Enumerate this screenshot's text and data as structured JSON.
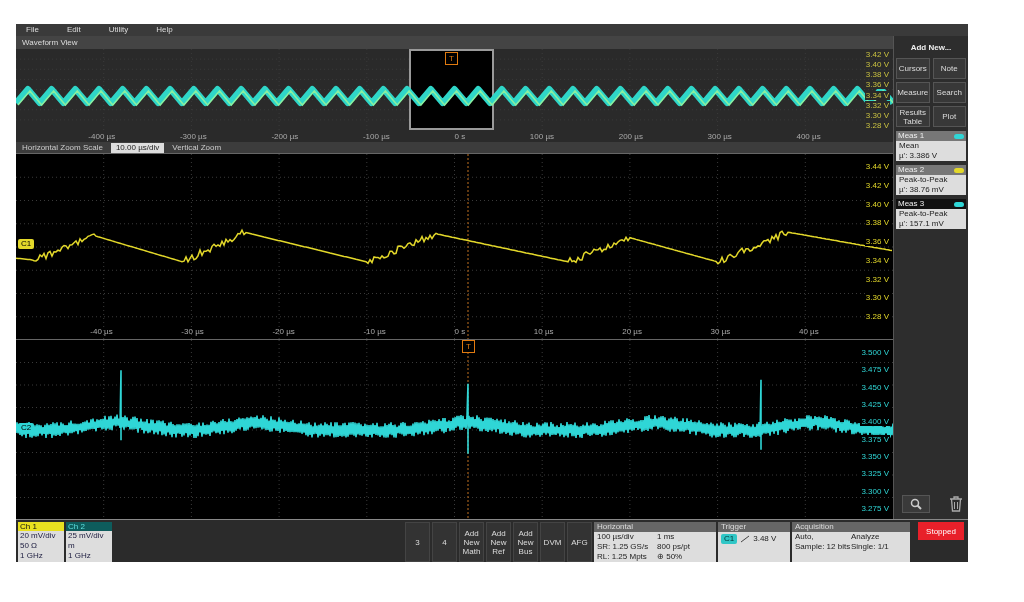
{
  "menu": [
    "File",
    "Edit",
    "Utility",
    "Help"
  ],
  "waveform_view": {
    "title": "Waveform View",
    "overview": {
      "x_labels": [
        "-400 µs",
        "-300 µs",
        "-200 µs",
        "-100 µs",
        "0 s",
        "100 µs",
        "200 µs",
        "300 µs",
        "400 µs"
      ],
      "y_labels": [
        "3.42 V",
        "3.40 V",
        "3.38 V",
        "3.36 V",
        "3.34 V",
        "3.32 V",
        "3.30 V",
        "3.28 V"
      ],
      "trigger_marker": "T"
    },
    "zoom_bar": {
      "label": "Horizontal Zoom Scale",
      "value": "10.00 µs/div",
      "vertical_label": "Vertical Zoom"
    },
    "plots": [
      {
        "channel": "C1",
        "color": "#e3d82a",
        "kind": "ramp",
        "y_labels": [
          "3.44 V",
          "3.42 V",
          "3.40 V",
          "3.38 V",
          "3.36 V",
          "3.34 V",
          "3.32 V",
          "3.30 V",
          "3.28 V"
        ],
        "x_labels": [
          "-40 µs",
          "-30 µs",
          "-20 µs",
          "-10 µs",
          "0 s",
          "10 µs",
          "20 µs",
          "30 µs",
          "40 µs"
        ]
      },
      {
        "channel": "C2",
        "color": "#2fd6d6",
        "kind": "noisy",
        "trigger_marker": "T",
        "y_labels": [
          "3.500 V",
          "3.475 V",
          "3.450 V",
          "3.425 V",
          "3.400 V",
          "3.375 V",
          "3.350 V",
          "3.325 V",
          "3.300 V",
          "3.275 V"
        ]
      }
    ]
  },
  "right_panel": {
    "title": "Add New...",
    "buttons": [
      "Cursors",
      "Note",
      "Measure",
      "Search",
      "Results Table",
      "Plot"
    ],
    "measurements": [
      {
        "badge": "Meas 1",
        "color": "#2fd6d6",
        "selected": false,
        "name": "Mean",
        "value": "µ': 3.386 V"
      },
      {
        "badge": "Meas 2",
        "color": "#e3d82a",
        "selected": false,
        "name": "Peak-to-Peak",
        "value": "µ': 38.76 mV"
      },
      {
        "badge": "Meas 3",
        "color": "#2fd6d6",
        "selected": true,
        "name": "Peak-to-Peak",
        "value": "µ': 157.1 mV"
      }
    ]
  },
  "bottom_bar": {
    "channels": [
      {
        "label": "Ch 1",
        "color": "#e8e020",
        "lines": [
          "20 mV/div",
          "50 Ω",
          "1 GHz"
        ]
      },
      {
        "label": "Ch 2",
        "color": "#0e5c5c",
        "lines": [
          "25 mV/div",
          "m",
          "1 GHz"
        ]
      }
    ],
    "buttons": [
      "3",
      "4",
      "Add New Math",
      "Add New Ref",
      "Add New Bus",
      "DVM",
      "AFG"
    ],
    "horizontal": {
      "title": "Horizontal",
      "cells": [
        "100 µs/div",
        "1 ms",
        "SR: 1.25 GS/s",
        "800 ps/pt",
        "RL: 1.25 Mpts",
        "⊕ 50%"
      ]
    },
    "trigger": {
      "title": "Trigger",
      "source": "C1",
      "value": "3.48 V"
    },
    "acquisition": {
      "title": "Acquisition",
      "cells": [
        "Auto,",
        "Analyze",
        "Sample: 12 bits",
        "Single: 1/1"
      ]
    },
    "run_state": "Stopped"
  }
}
